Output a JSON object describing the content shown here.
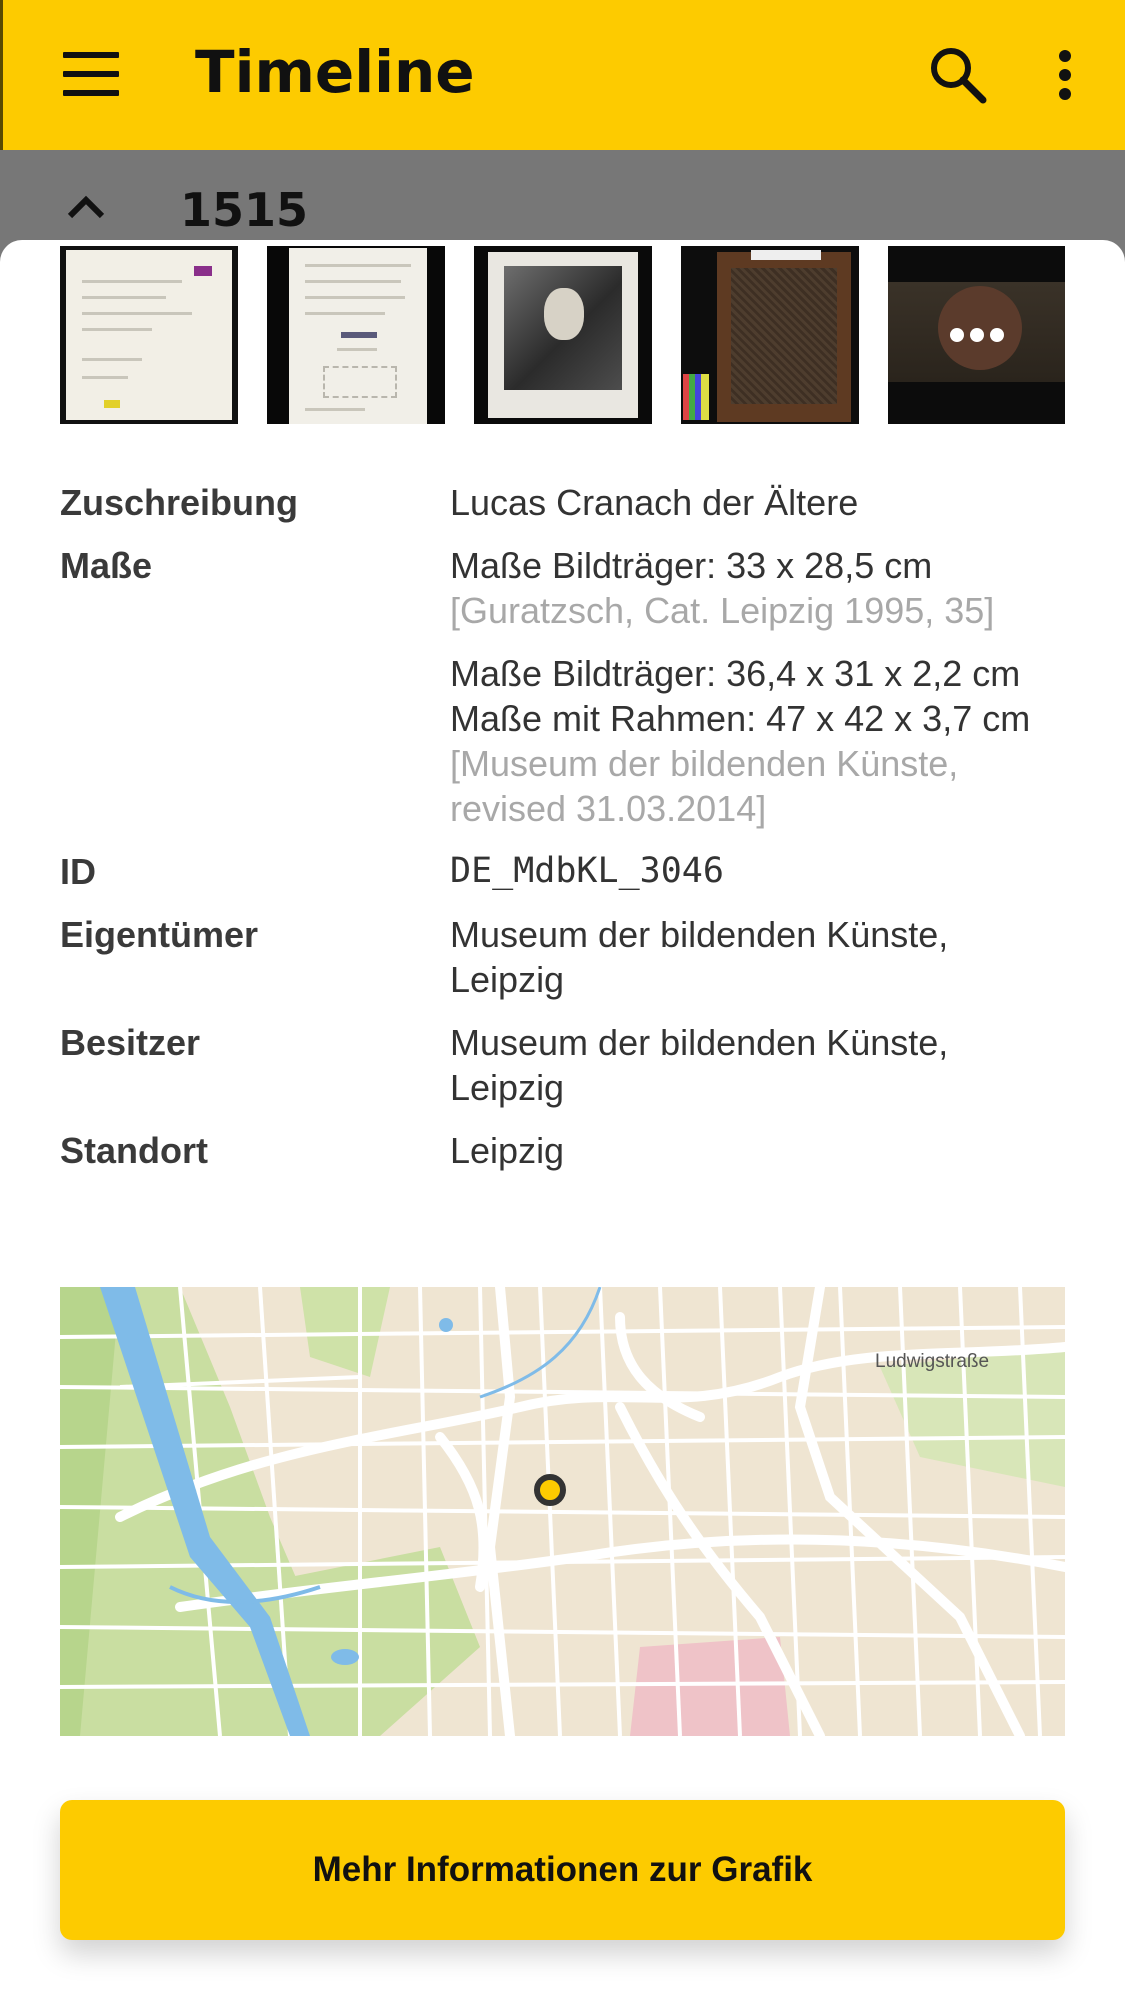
{
  "app_bar": {
    "title": "Timeline",
    "menu_icon": "hamburger-menu-icon",
    "search_icon": "search-icon",
    "more_icon": "more-vert-icon",
    "background_color": "#fdcb00"
  },
  "section": {
    "year": "1515",
    "toggle_icon": "chevron-up-icon"
  },
  "thumbnails": [
    {
      "name": "inscription-sheet-thumbnail"
    },
    {
      "name": "document-sheet-thumbnail"
    },
    {
      "name": "portrait-print-thumbnail"
    },
    {
      "name": "panel-back-thumbnail"
    },
    {
      "name": "seal-detail-thumbnail",
      "overlay_icon": "more-horiz-icon"
    }
  ],
  "details": {
    "attribution": {
      "label": "Zuschreibung",
      "value": "Lucas Cranach der Ältere"
    },
    "dimensions": {
      "label": "Maße",
      "entries": [
        {
          "lines": [
            "Maße Bildträger: 33 x 28,5 cm"
          ],
          "reference": "[Guratzsch, Cat. Leipzig 1995, 35]"
        },
        {
          "lines": [
            "Maße Bildträger: 36,4 x 31 x 2,2 cm",
            "Maße mit Rahmen: 47 x 42 x 3,7 cm"
          ],
          "reference_lines": [
            "[Museum der bildenden Künste,",
            "revised 31.03.2014]"
          ]
        }
      ]
    },
    "id": {
      "label": "ID",
      "value": "DE_MdbKL_3046"
    },
    "owner": {
      "label": "Eigentümer",
      "lines": [
        "Museum der bildenden Künste,",
        "Leipzig"
      ]
    },
    "holder": {
      "label": "Besitzer",
      "lines": [
        "Museum der bildenden Künste,",
        "Leipzig"
      ]
    },
    "location": {
      "label": "Standort",
      "value": "Leipzig"
    }
  },
  "map": {
    "street_label": "Ludwigstraße",
    "marker_icon": "location-pin-icon"
  },
  "cta": {
    "label": "Mehr Informationen zur Grafik"
  }
}
